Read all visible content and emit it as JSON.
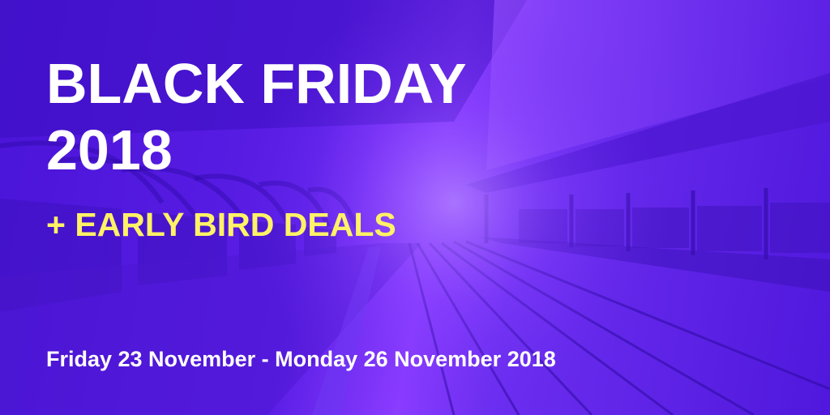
{
  "banner": {
    "title_line1": "BLACK FRIDAY",
    "title_line2": "2018",
    "subtitle": "+ EARLY BIRD DEALS",
    "dates": "Friday 23 November - Monday 26 November 2018"
  },
  "colors": {
    "overlay": "#5a1fe0",
    "title": "#ffffff",
    "subtitle": "#fff266"
  }
}
